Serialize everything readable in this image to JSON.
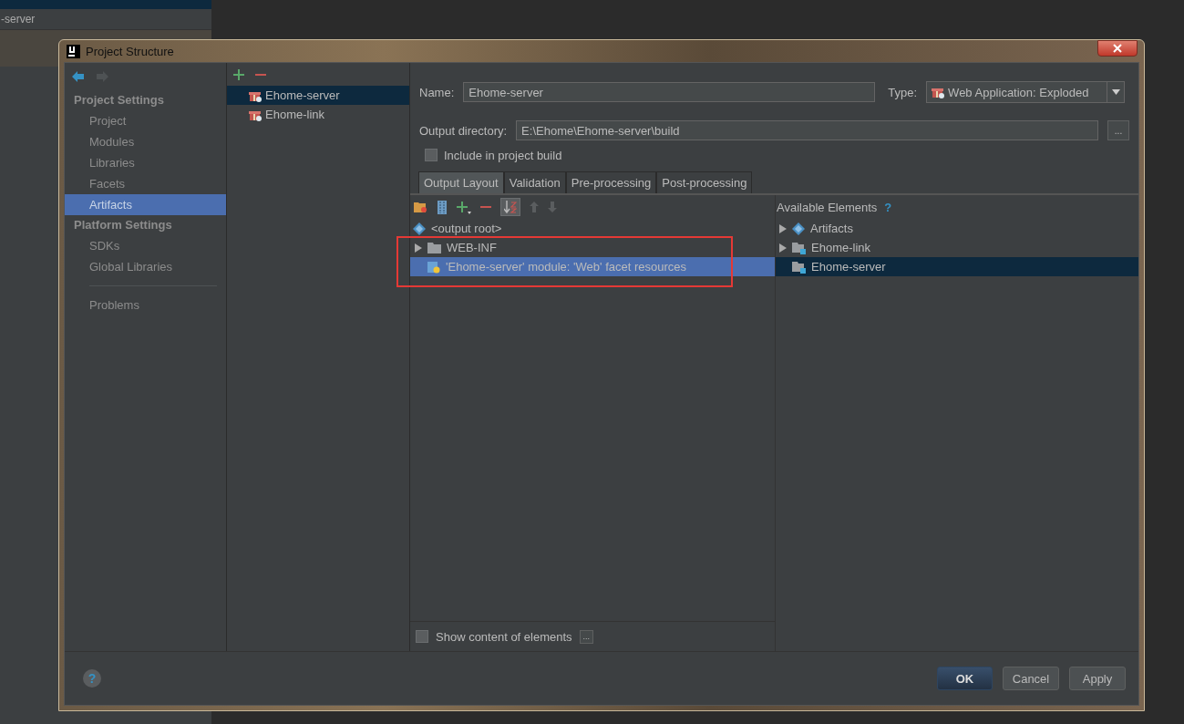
{
  "background": {
    "texts": [
      "-server"
    ]
  },
  "window": {
    "title": "Project Structure"
  },
  "nav": {
    "sections": [
      {
        "heading": "Project Settings",
        "items": [
          {
            "label": "Project",
            "selected": false
          },
          {
            "label": "Modules",
            "selected": false
          },
          {
            "label": "Libraries",
            "selected": false
          },
          {
            "label": "Facets",
            "selected": false
          },
          {
            "label": "Artifacts",
            "selected": true
          }
        ]
      },
      {
        "heading": "Platform Settings",
        "items": [
          {
            "label": "SDKs",
            "selected": false
          },
          {
            "label": "Global Libraries",
            "selected": false
          }
        ]
      }
    ],
    "extra": [
      {
        "label": "Problems",
        "selected": false
      }
    ]
  },
  "artifacts": [
    {
      "name": "Ehome-server",
      "selected": true
    },
    {
      "name": "Ehome-link",
      "selected": false
    }
  ],
  "form": {
    "name_label": "Name:",
    "name": "Ehome-server",
    "type_label": "Type:",
    "type": "Web Application: Exploded",
    "output_label": "Output directory:",
    "output": "E:\\Ehome\\Ehome-server\\build",
    "browse": "...",
    "include": {
      "label": "Include in project build",
      "checked": false
    }
  },
  "tabs": [
    {
      "label": "Output Layout",
      "selected": true
    },
    {
      "label": "Validation",
      "selected": false
    },
    {
      "label": "Pre-processing",
      "selected": false
    },
    {
      "label": "Post-processing",
      "selected": false
    }
  ],
  "layout_tree": [
    {
      "label": "<output root>",
      "kind": "root",
      "selected": false,
      "children": [
        {
          "label": "WEB-INF",
          "kind": "folder",
          "expanded": false,
          "selected": false
        },
        {
          "label": "'Ehome-server' module: 'Web' facet resources",
          "kind": "resource",
          "selected": true
        }
      ]
    }
  ],
  "available": {
    "title": "Available Elements",
    "help": "?",
    "items": [
      {
        "label": "Artifacts",
        "kind": "artifacts",
        "expanded": false,
        "selected": false
      },
      {
        "label": "Ehome-link",
        "kind": "module",
        "expanded": false,
        "selected": false
      },
      {
        "label": "Ehome-server",
        "kind": "module",
        "selected": true
      }
    ]
  },
  "show_content": {
    "label": "Show content of elements",
    "checked": false,
    "more": "..."
  },
  "help": "?",
  "buttons": [
    {
      "label": "OK",
      "kind": "default"
    },
    {
      "label": "Cancel",
      "kind": "normal"
    },
    {
      "label": "Apply",
      "kind": "normal"
    }
  ]
}
